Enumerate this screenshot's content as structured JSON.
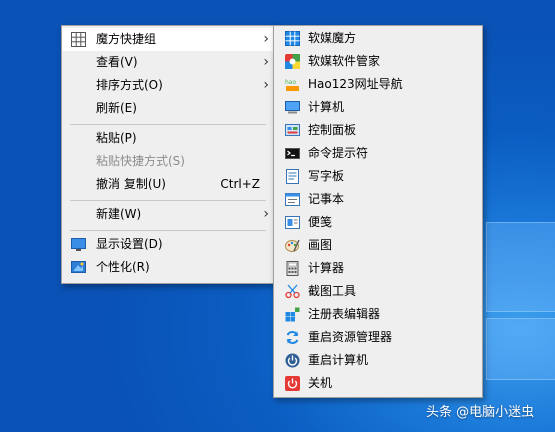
{
  "context_menu": {
    "items": [
      {
        "label": "魔方快捷组"
      },
      {
        "label": "查看(V)"
      },
      {
        "label": "排序方式(O)"
      },
      {
        "label": "刷新(E)"
      },
      {
        "label": "粘贴(P)"
      },
      {
        "label": "粘贴快捷方式(S)"
      },
      {
        "label": "撤消 复制(U)",
        "shortcut": "Ctrl+Z"
      },
      {
        "label": "新建(W)"
      },
      {
        "label": "显示设置(D)"
      },
      {
        "label": "个性化(R)"
      }
    ]
  },
  "submenu": {
    "items": [
      {
        "label": "软媒魔方"
      },
      {
        "label": "软媒软件管家"
      },
      {
        "label": "Hao123网址导航"
      },
      {
        "label": "计算机"
      },
      {
        "label": "控制面板"
      },
      {
        "label": "命令提示符"
      },
      {
        "label": "写字板"
      },
      {
        "label": "记事本"
      },
      {
        "label": "便笺"
      },
      {
        "label": "画图"
      },
      {
        "label": "计算器"
      },
      {
        "label": "截图工具"
      },
      {
        "label": "注册表编辑器"
      },
      {
        "label": "重启资源管理器"
      },
      {
        "label": "重启计算机"
      },
      {
        "label": "关机"
      }
    ]
  },
  "hao123_icon_text": "hao",
  "watermark": "头条 @电脑小迷虫"
}
